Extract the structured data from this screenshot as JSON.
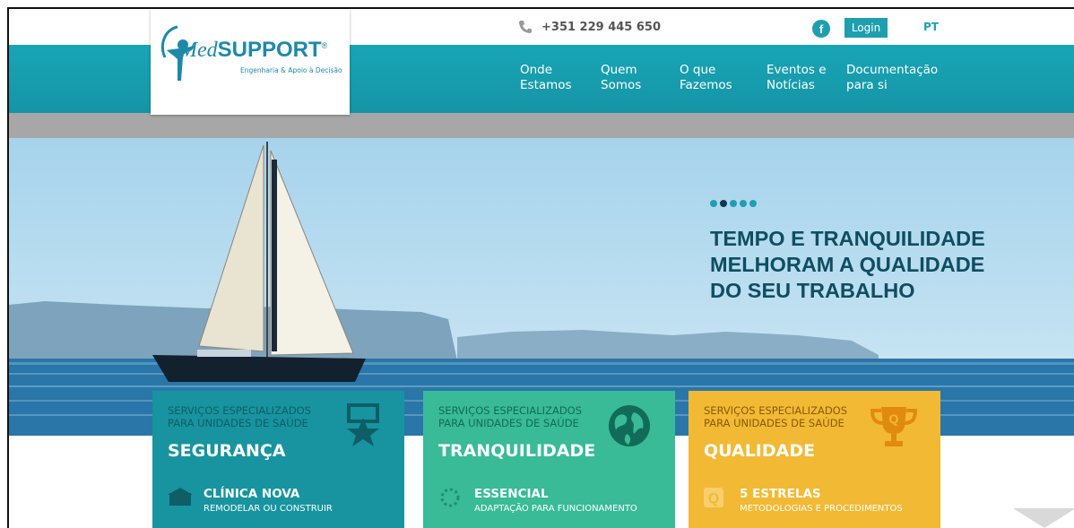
{
  "header": {
    "phone": "+351 229 445 650",
    "facebook_label": "f",
    "login_label": "Login",
    "language": "PT",
    "logo": {
      "name": "MedSUPPORT",
      "tagline": "Engenharia & Apoio à Decisão"
    }
  },
  "nav": {
    "items": [
      {
        "line1": "Onde",
        "line2": "Estamos"
      },
      {
        "line1": "Quem",
        "line2": "Somos"
      },
      {
        "line1": "O que",
        "line2": "Fazemos"
      },
      {
        "line1": "Eventos e",
        "line2": "Notícias"
      },
      {
        "line1": "Documentação",
        "line2": "para si"
      }
    ]
  },
  "hero": {
    "headline_lines": [
      "TEMPO E TRANQUILIDADE",
      "MELHORAM A QUALIDADE",
      "DO SEU TRABALHO"
    ],
    "slides_total": 5,
    "active_slide": 2
  },
  "cards": [
    {
      "subtitle_line1": "SERVIÇOS ESPECIALIZADOS",
      "subtitle_line2": "PARA UNIDADES DE SAÚDE",
      "title": "SEGURANÇA",
      "feature_title": "CLÍNICA NOVA",
      "feature_sub": "REMODELAR OU CONSTRUIR",
      "color": "#17949f",
      "icon": "award-ribbon-icon"
    },
    {
      "subtitle_line1": "SERVIÇOS ESPECIALIZADOS",
      "subtitle_line2": "PARA UNIDADES DE SAÚDE",
      "title": "TRANQUILIDADE",
      "feature_title": "ESSENCIAL",
      "feature_sub": "ADAPTAÇÃO PARA FUNCIONAMENTO",
      "color": "#38bb96",
      "icon": "globe-icon"
    },
    {
      "subtitle_line1": "SERVIÇOS ESPECIALIZADOS",
      "subtitle_line2": "PARA UNIDADES DE SAÚDE",
      "title": "QUALIDADE",
      "feature_title": "5 ESTRELAS",
      "feature_sub": "METODOLOGIAS E PROCEDIMENTOS",
      "color": "#f2b934",
      "icon": "trophy-icon"
    }
  ],
  "colors": {
    "brand_teal": "#1e9fb0",
    "headline": "#0f4e62"
  }
}
